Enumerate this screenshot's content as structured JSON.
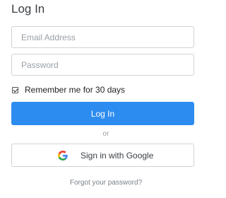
{
  "title": "Log In",
  "email": {
    "placeholder": "Email Address",
    "value": ""
  },
  "password": {
    "placeholder": "Password",
    "value": ""
  },
  "remember": {
    "label": "Remember me for 30 days",
    "checked": true
  },
  "login_button": {
    "label": "Log In"
  },
  "divider_text": "or",
  "google_button": {
    "label": "Sign in with Google",
    "icon": "google-g-icon"
  },
  "forgot_link": "Forgot your password?",
  "colors": {
    "primary": "#2d8cf0",
    "border": "#cfd3d7",
    "text": "#3a3f44",
    "muted": "#9aa0a6"
  }
}
